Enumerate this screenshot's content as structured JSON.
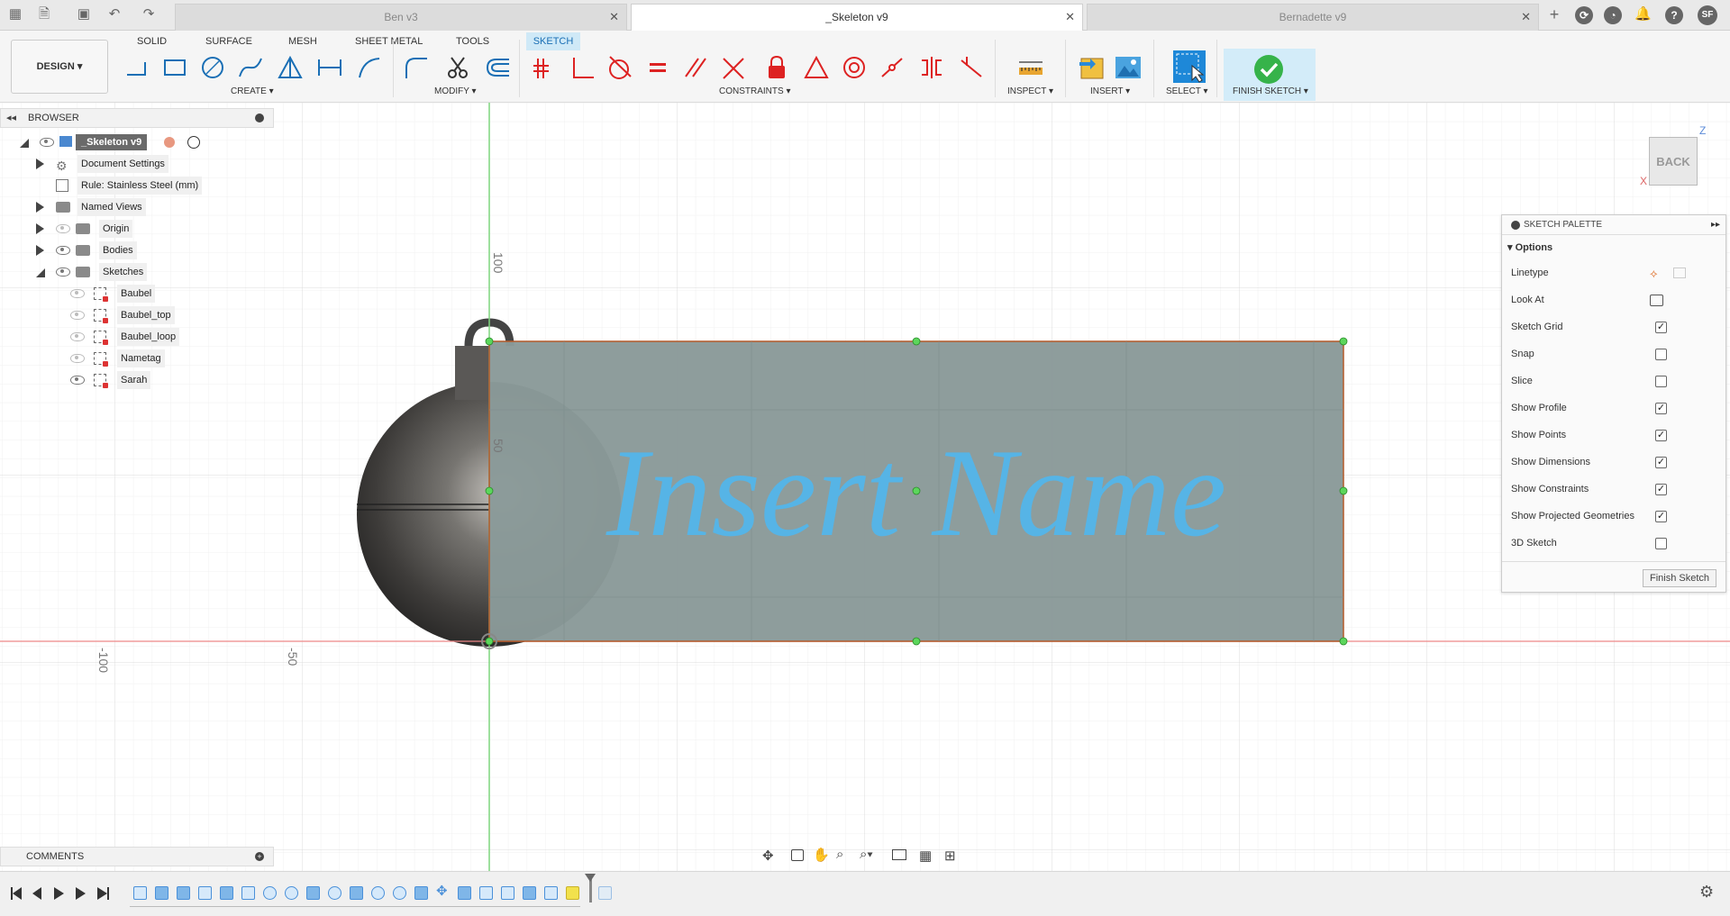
{
  "tabs": [
    {
      "label": "Ben v3"
    },
    {
      "label": "_Skeleton v9"
    },
    {
      "label": "Bernadette v9"
    }
  ],
  "user_initials": "SF",
  "workspace": {
    "label": "DESIGN"
  },
  "workspace_tabs": [
    "SOLID",
    "SURFACE",
    "MESH",
    "SHEET METAL",
    "TOOLS",
    "SKETCH"
  ],
  "active_workspace_tab": "SKETCH",
  "groups": {
    "create": "CREATE",
    "modify": "MODIFY",
    "constraints": "CONSTRAINTS",
    "inspect": "INSPECT",
    "insert": "INSERT",
    "select": "SELECT",
    "finish": "FINISH SKETCH"
  },
  "browser": {
    "title": "BROWSER",
    "root": "_Skeleton v9",
    "items": [
      {
        "label": "Document Settings"
      },
      {
        "label": "Rule: Stainless Steel (mm)"
      },
      {
        "label": "Named Views"
      },
      {
        "label": "Origin"
      },
      {
        "label": "Bodies"
      },
      {
        "label": "Sketches"
      }
    ],
    "sketches": [
      {
        "label": "Baubel"
      },
      {
        "label": "Baubel_top"
      },
      {
        "label": "Baubel_loop"
      },
      {
        "label": "Nametag"
      },
      {
        "label": "Sarah"
      }
    ]
  },
  "comments": {
    "title": "COMMENTS"
  },
  "viewcube": {
    "face": "BACK",
    "axis_z": "Z",
    "axis_x": "X"
  },
  "axis_labels": {
    "v100": "100",
    "v50": "50",
    "h100": "-100",
    "h50": "-50"
  },
  "sketch_text": "Insert Name",
  "colors": {
    "sketch_text": "#56b4e6",
    "profile_fill": "#8a9a99",
    "accent": "#0696d7"
  },
  "palette": {
    "title": "SKETCH PALETTE",
    "section": "Options",
    "rows": [
      {
        "label": "Linetype",
        "type": "icons"
      },
      {
        "label": "Look At",
        "type": "icon"
      },
      {
        "label": "Sketch Grid",
        "checked": true
      },
      {
        "label": "Snap",
        "checked": false
      },
      {
        "label": "Slice",
        "checked": false
      },
      {
        "label": "Show Profile",
        "checked": true
      },
      {
        "label": "Show Points",
        "checked": true
      },
      {
        "label": "Show Dimensions",
        "checked": true
      },
      {
        "label": "Show Constraints",
        "checked": true
      },
      {
        "label": "Show Projected Geometries",
        "checked": true
      },
      {
        "label": "3D Sketch",
        "checked": false
      }
    ],
    "finish_button": "Finish Sketch"
  },
  "check_glyph": "✓"
}
